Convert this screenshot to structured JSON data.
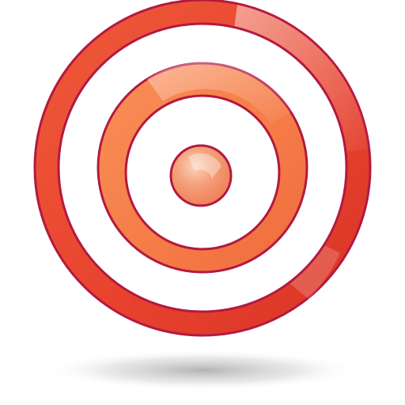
{
  "icon": {
    "name": "target-icon",
    "colors": {
      "outer_ring": "#ee4a34",
      "outer_ring_light": "#f26b4e",
      "middle_ring": "#f78a55",
      "middle_ring_light": "#fb9a63",
      "bullseye": "#f3865c",
      "outline": "#b3193f",
      "gap": "#ffffff",
      "shadow": "#a5a5a5"
    }
  }
}
